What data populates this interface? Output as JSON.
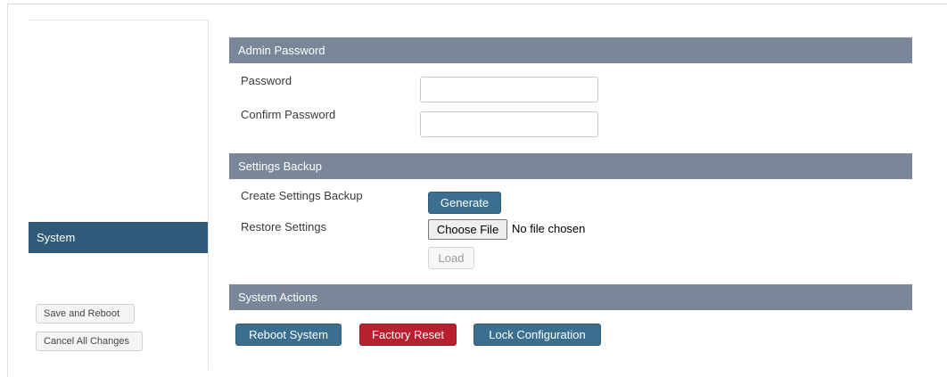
{
  "sidebar": {
    "active_item": "System",
    "save_label": "Save and Reboot",
    "cancel_label": "Cancel All Changes"
  },
  "admin_password": {
    "title": "Admin Password",
    "password_label": "Password",
    "password_value": "",
    "confirm_label": "Confirm Password",
    "confirm_value": ""
  },
  "settings_backup": {
    "title": "Settings Backup",
    "create_label": "Create Settings Backup",
    "generate_label": "Generate",
    "restore_label": "Restore Settings",
    "choose_file_label": "Choose File",
    "file_status": "No file chosen",
    "load_label": "Load"
  },
  "system_actions": {
    "title": "System Actions",
    "reboot_label": "Reboot System",
    "factory_reset_label": "Factory Reset",
    "lock_label": "Lock Configuration"
  },
  "colors": {
    "section_header": "#798799",
    "sidebar_active": "#2f5a7a",
    "primary_button": "#3b6f8f",
    "danger_button": "#b7202e"
  }
}
